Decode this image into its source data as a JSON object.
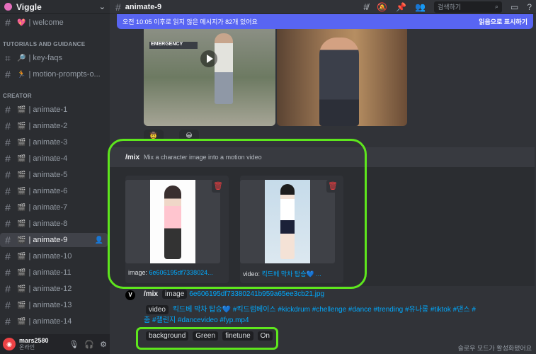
{
  "server": {
    "name": "Viggle"
  },
  "sidebar": {
    "welcome": {
      "emoji": "💖",
      "label": "| welcome"
    },
    "category_tutorials": "TUTORIALS AND GUIDANCE",
    "tutorials": [
      {
        "emoji": "🔎",
        "label": "| key-faqs"
      },
      {
        "emoji": "🏃",
        "label": "| motion-prompts-o..."
      }
    ],
    "category_creator": "CREATOR",
    "channels": [
      {
        "emoji": "🎬",
        "label": "| animate-1"
      },
      {
        "emoji": "🎬",
        "label": "| animate-2"
      },
      {
        "emoji": "🎬",
        "label": "| animate-3"
      },
      {
        "emoji": "🎬",
        "label": "| animate-4"
      },
      {
        "emoji": "🎬",
        "label": "| animate-5"
      },
      {
        "emoji": "🎬",
        "label": "| animate-6"
      },
      {
        "emoji": "🎬",
        "label": "| animate-7"
      },
      {
        "emoji": "🎬",
        "label": "| animate-8"
      },
      {
        "emoji": "🎬",
        "label": "| animate-9"
      },
      {
        "emoji": "🎬",
        "label": "| animate-10"
      },
      {
        "emoji": "🎬",
        "label": "| animate-11"
      },
      {
        "emoji": "🎬",
        "label": "| animate-12"
      },
      {
        "emoji": "🎬",
        "label": "| animate-13"
      },
      {
        "emoji": "🎬",
        "label": "| animate-14"
      }
    ],
    "active_index": 8
  },
  "user": {
    "name": "mars2580",
    "status": "온라인"
  },
  "topbar": {
    "channel_title": "animate-9",
    "search_placeholder": "검색하기"
  },
  "new_messages": {
    "text": "오전 10:05 이후로 읽지 않은 메시지가 82개 있어요",
    "mark_read": "읽음으로 표시하기"
  },
  "media": {
    "sign_text": "EMERGENCY"
  },
  "reactions": [
    "🤠",
    "😀"
  ],
  "command_panel": {
    "command": "/mix",
    "description": "Mix a character image into a motion video",
    "attachments": [
      {
        "prefix": "image: ",
        "value": "6e606195df7338024..."
      },
      {
        "prefix": "video: ",
        "value": "킥드베 막차 탑승💙 ..."
      }
    ]
  },
  "message": {
    "command": "/mix",
    "image_label": "image",
    "image_value": "6e606195df73380241b959a65ee3cb21.jpg",
    "video_label": "video",
    "video_value": "킥드베 막차 탑승💙 #킥드럼베이스 #kickdrum #chellenge #dance #trending #유나롱 #tiktok #댄스 #춤 #챌린지 #dancevideo #fyp.mp4",
    "background_label": "background",
    "background_value": "Green",
    "finetune_label": "finetune",
    "finetune_value": "On"
  },
  "slowmode_text": "슬로우 모드가 활성화됐어요",
  "colors": {
    "accent": "#5865f2",
    "highlight": "#5ee61d",
    "link": "#00a8fc",
    "danger": "#f23f42"
  }
}
